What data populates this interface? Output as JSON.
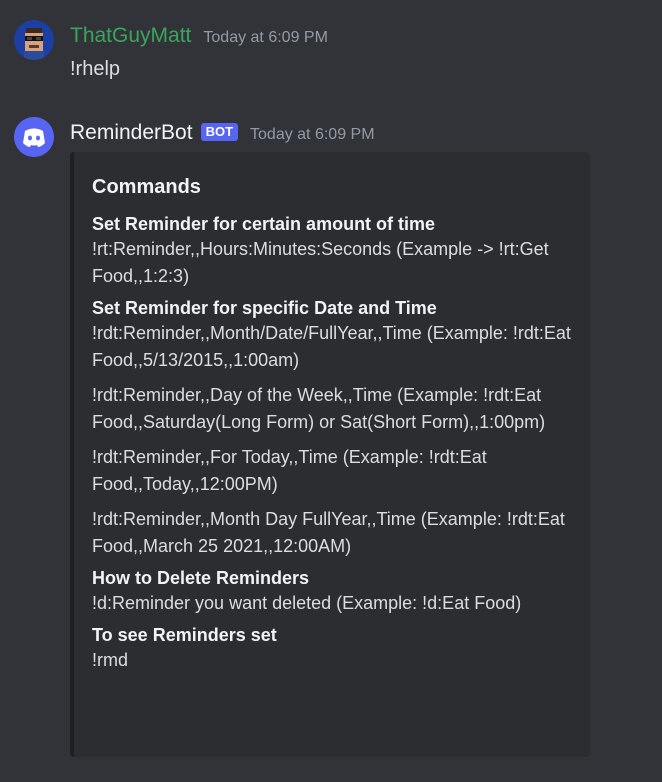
{
  "messages": [
    {
      "username": "ThatGuyMatt",
      "username_color": "#3ba55d",
      "timestamp": "Today at 6:09 PM",
      "content": "!rhelp"
    },
    {
      "username": "ReminderBot",
      "username_color": "#f2f3f5",
      "bot_tag": "BOT",
      "timestamp": "Today at 6:09 PM",
      "embed": {
        "title": "Commands",
        "fields": [
          {
            "name": "Set Reminder for certain amount of time",
            "value": "!rt:Reminder,,Hours:Minutes:Seconds (Example -> !rt:Get Food,,1:2:3)"
          },
          {
            "name": "Set Reminder for specific Date and Time",
            "value": "!rdt:Reminder,,Month/Date/FullYear,,Time (Example: !rdt:Eat Food,,5/13/2015,,1:00am)"
          },
          {
            "value": "!rdt:Reminder,,Day of the Week,,Time (Example: !rdt:Eat Food,,Saturday(Long Form) or Sat(Short Form),,1:00pm)"
          },
          {
            "value": "!rdt:Reminder,,For Today,,Time (Example: !rdt:Eat Food,,Today,,12:00PM)"
          },
          {
            "value": "!rdt:Reminder,,Month Day FullYear,,Time (Example: !rdt:Eat Food,,March 25 2021,,12:00AM)"
          },
          {
            "name": "How to Delete Reminders",
            "value": "!d:Reminder you want deleted (Example: !d:Eat Food)"
          },
          {
            "name": "To see Reminders set",
            "value": "!rmd"
          }
        ]
      }
    }
  ],
  "icons": {
    "user_avatar": "pixel-sunglasses-avatar-icon",
    "bot_avatar": "discord-logo-icon"
  },
  "colors": {
    "background": "#313338",
    "embed_bg": "#2b2d31",
    "bot_tag": "#5865f2",
    "timestamp": "#949ba4"
  }
}
